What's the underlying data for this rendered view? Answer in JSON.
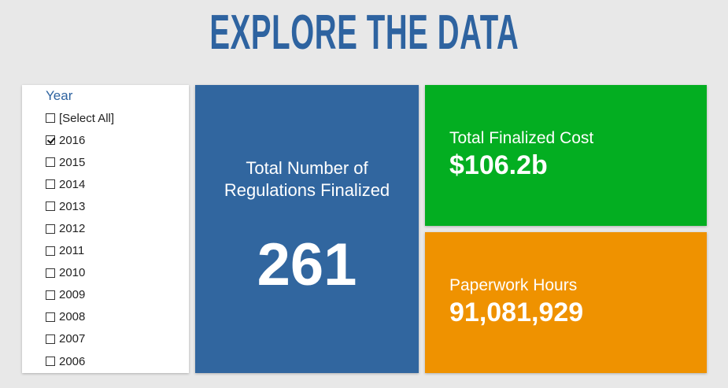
{
  "header": {
    "title": "EXPLORE THE DATA"
  },
  "filter": {
    "heading": "Year",
    "items": [
      {
        "label": "[Select All]",
        "checked": false
      },
      {
        "label": "2016",
        "checked": true
      },
      {
        "label": "2015",
        "checked": false
      },
      {
        "label": "2014",
        "checked": false
      },
      {
        "label": "2013",
        "checked": false
      },
      {
        "label": "2012",
        "checked": false
      },
      {
        "label": "2011",
        "checked": false
      },
      {
        "label": "2010",
        "checked": false
      },
      {
        "label": "2009",
        "checked": false
      },
      {
        "label": "2008",
        "checked": false
      },
      {
        "label": "2007",
        "checked": false
      },
      {
        "label": "2006",
        "checked": false
      }
    ]
  },
  "tiles": {
    "regulations": {
      "label": "Total Number of Regulations Finalized",
      "value": "261",
      "color": "#31669f"
    },
    "cost": {
      "label": "Total Finalized Cost",
      "value": "$106.2b",
      "color": "#03ae21"
    },
    "hours": {
      "label": "Paperwork Hours",
      "value": "91,081,929",
      "color": "#ef9200"
    }
  }
}
